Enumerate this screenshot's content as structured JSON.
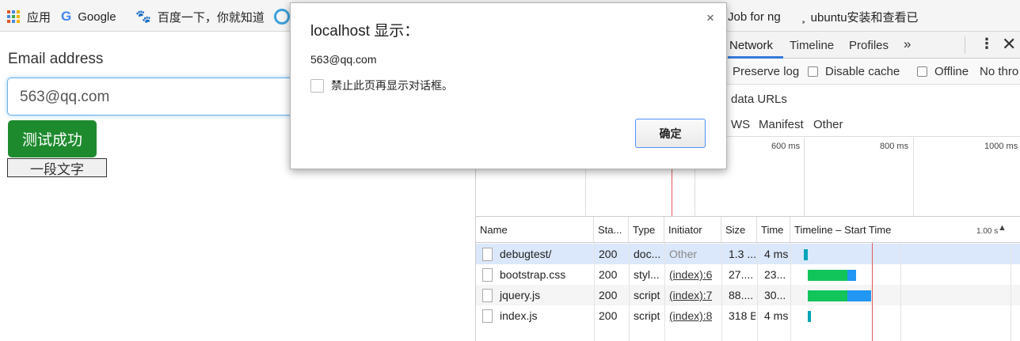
{
  "bookmarks": {
    "apps_label": "应用",
    "google_label": "Google",
    "baidu_label": "百度一下，你就知道",
    "job_label": "Job for ng",
    "ubuntu_label": "ubuntu安装和查看已"
  },
  "page": {
    "email_label": "Email address",
    "email_value": "563@qq.com",
    "success_button": "测试成功",
    "text_button": "一段文字"
  },
  "devtools": {
    "tabs": [
      "Network",
      "Timeline",
      "Profiles"
    ],
    "active_tab": "Network",
    "more_label": "»",
    "kebab_label": "⋮",
    "close_label": "✕",
    "toolbar": {
      "preserve_log": "Preserve log",
      "disable_cache": "Disable cache",
      "offline": "Offline",
      "throttle": "No thro"
    },
    "filter": {
      "data_urls": "data URLs",
      "types": [
        "WS",
        "Manifest",
        "Other"
      ]
    },
    "overview_ticks": [
      "600 ms",
      "800 ms",
      "1000 ms"
    ],
    "columns": [
      "Name",
      "Sta...",
      "Type",
      "Initiator",
      "Size",
      "Time",
      "Timeline – Start Time"
    ],
    "timeline_tick": "1.00 s",
    "rows": [
      {
        "name": "debugtest/",
        "status": "200",
        "type": "doc...",
        "initiator": "Other",
        "size": "1.3 ...",
        "time": "4 ms"
      },
      {
        "name": "bootstrap.css",
        "status": "200",
        "type": "styl...",
        "initiator": "(index):6",
        "size": "27....",
        "time": "23..."
      },
      {
        "name": "jquery.js",
        "status": "200",
        "type": "script",
        "initiator": "(index):7",
        "size": "88....",
        "time": "30..."
      },
      {
        "name": "index.js",
        "status": "200",
        "type": "script",
        "initiator": "(index):8",
        "size": "318 B",
        "time": "4 ms"
      }
    ]
  },
  "dialog": {
    "title": "localhost 显示：",
    "message": "563@qq.com",
    "suppress_label": "禁止此页再显示对话框。",
    "ok_button": "确定",
    "close_label": "×"
  },
  "colors": {
    "success_button": "#1e8a2e",
    "waiting_bar": "#12c55a",
    "download_bar": "#2196f3",
    "timeline_red": "#e05a5a",
    "selected_row": "#dbe8fb"
  }
}
